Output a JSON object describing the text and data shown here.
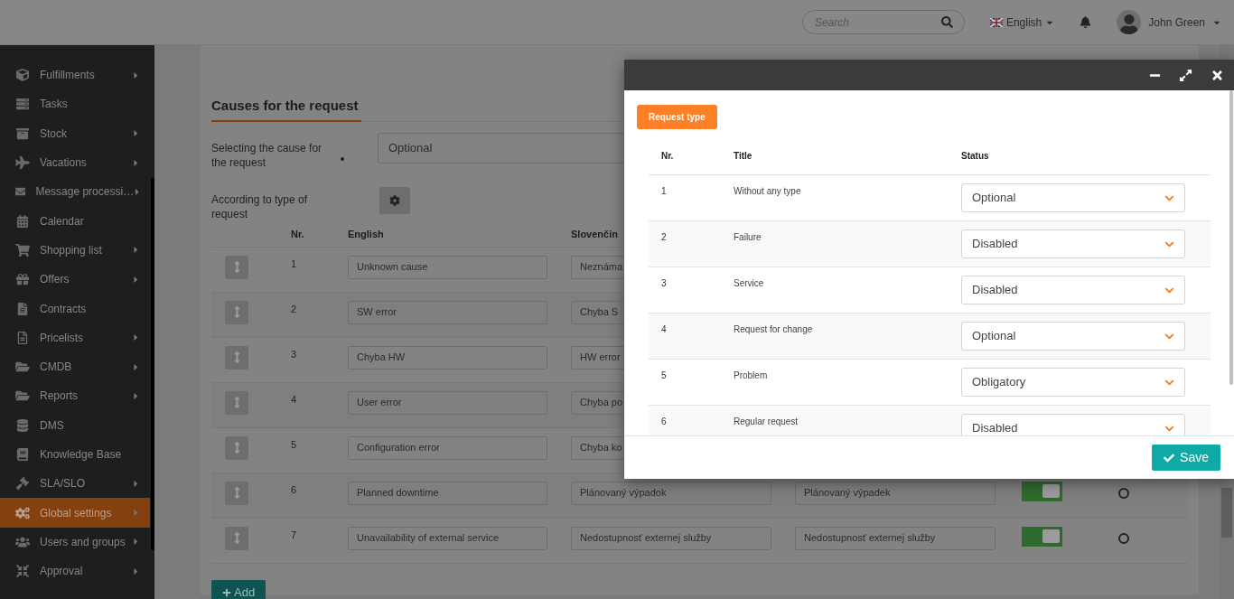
{
  "topbar": {
    "search": {
      "placeholder": "Search"
    },
    "language": "English",
    "user": "John Green"
  },
  "sidebar": {
    "items": [
      {
        "label": "Fulfillments",
        "submenu": true,
        "selected": false
      },
      {
        "label": "Tasks",
        "submenu": false,
        "selected": false
      },
      {
        "label": "Stock",
        "submenu": true,
        "selected": false
      },
      {
        "label": "Vacations",
        "submenu": true,
        "selected": false
      },
      {
        "label": "Message processi…",
        "submenu": true,
        "selected": false
      },
      {
        "label": "Calendar",
        "submenu": false,
        "selected": false
      },
      {
        "label": "Shopping list",
        "submenu": true,
        "selected": false
      },
      {
        "label": "Offers",
        "submenu": true,
        "selected": false
      },
      {
        "label": "Contracts",
        "submenu": false,
        "selected": false
      },
      {
        "label": "Pricelists",
        "submenu": true,
        "selected": false
      },
      {
        "label": "CMDB",
        "submenu": true,
        "selected": false
      },
      {
        "label": "Reports",
        "submenu": true,
        "selected": false
      },
      {
        "label": "DMS",
        "submenu": false,
        "selected": false
      },
      {
        "label": "Knowledge Base",
        "submenu": false,
        "selected": false
      },
      {
        "label": "SLA/SLO",
        "submenu": true,
        "selected": false
      },
      {
        "label": "Global settings",
        "submenu": true,
        "selected": true
      },
      {
        "label": "Users and groups",
        "submenu": true,
        "selected": false
      },
      {
        "label": "Approval",
        "submenu": true,
        "selected": false
      }
    ]
  },
  "section": {
    "title": "Causes for the request",
    "cause_selection": {
      "label": "Selecting the cause for the request",
      "required": true,
      "value": "Optional"
    },
    "by_type": {
      "label": "According to type of request"
    },
    "table": {
      "columns": [
        "Nr.",
        "English",
        "Slovenčin"
      ],
      "rows": [
        {
          "nr": "1",
          "english": "Unknown cause",
          "slovak": "Neznáma"
        },
        {
          "nr": "2",
          "english": "SW error",
          "slovak": "Chyba S"
        },
        {
          "nr": "3",
          "english": "Chyba HW",
          "slovak": "HW error"
        },
        {
          "nr": "4",
          "english": "User error",
          "slovak": "Chyba po"
        },
        {
          "nr": "5",
          "english": "Configuration error",
          "slovak": "Chyba ko"
        },
        {
          "nr": "6",
          "english": "Planned downtime",
          "slovak": "Plánovaný výpadok",
          "column_4": "Plánovaný výpadek",
          "on": true,
          "selected": false
        },
        {
          "nr": "7",
          "english": "Unavailability of external service",
          "slovak": "Nedostupnosť externej služby",
          "column_4": "Nedostupnosť externej služby",
          "on": true,
          "selected": false
        }
      ]
    },
    "add_button": "Add"
  },
  "modal": {
    "tab": "Request type",
    "columns": [
      "Nr.",
      "Title",
      "Status"
    ],
    "rows": [
      {
        "nr": "1",
        "title": "Without any type",
        "status": "Optional"
      },
      {
        "nr": "2",
        "title": "Failure",
        "status": "Disabled"
      },
      {
        "nr": "3",
        "title": "Service",
        "status": "Disabled"
      },
      {
        "nr": "4",
        "title": "Request for change",
        "status": "Optional"
      },
      {
        "nr": "5",
        "title": "Problem",
        "status": "Obligatory"
      },
      {
        "nr": "6",
        "title": "Regular request",
        "status": "Disabled"
      }
    ],
    "save_button": "Save"
  }
}
